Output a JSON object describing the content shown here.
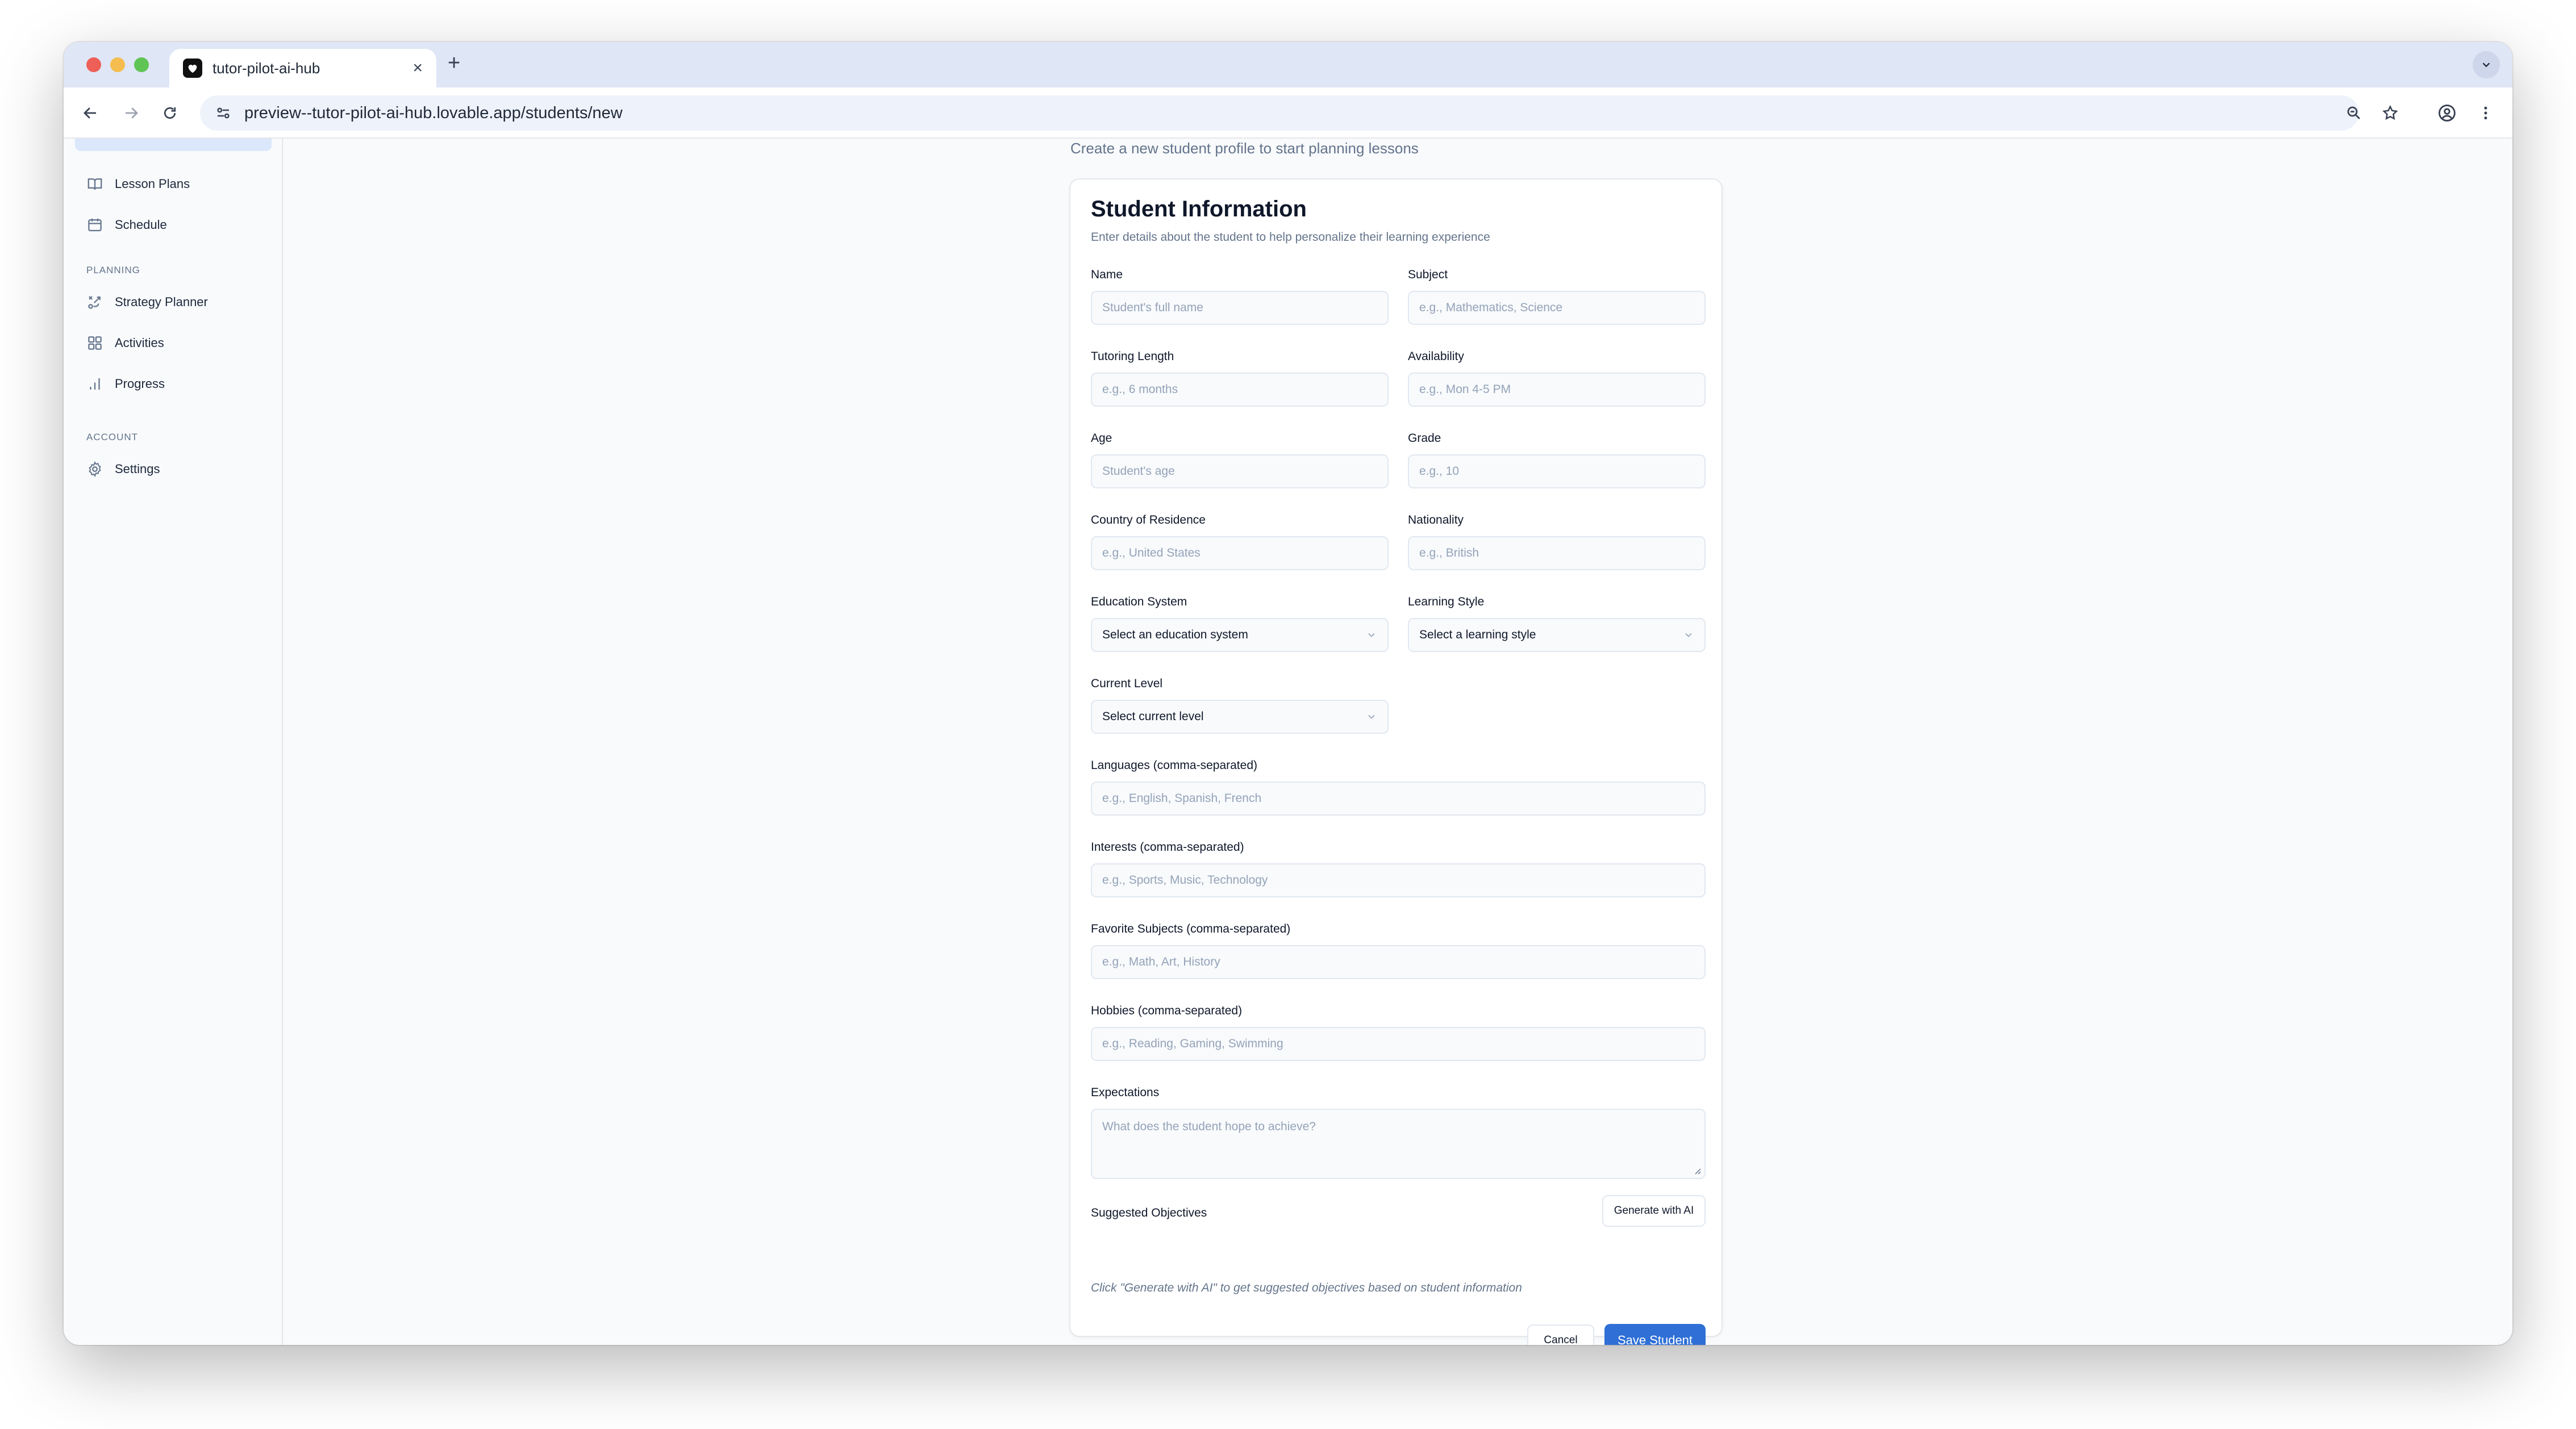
{
  "browser": {
    "tab_title": "tutor-pilot-ai-hub",
    "url": "preview--tutor-pilot-ai-hub.lovable.app/students/new"
  },
  "sidebar": {
    "items_top": [
      {
        "label": "Lesson Plans",
        "icon": "book-open-icon"
      },
      {
        "label": "Schedule",
        "icon": "calendar-icon"
      }
    ],
    "groups": [
      {
        "label": "PLANNING",
        "items": [
          {
            "label": "Strategy Planner",
            "icon": "strategy-icon"
          },
          {
            "label": "Activities",
            "icon": "grid-icon"
          },
          {
            "label": "Progress",
            "icon": "bar-chart-icon"
          }
        ]
      },
      {
        "label": "ACCOUNT",
        "items": [
          {
            "label": "Settings",
            "icon": "gear-icon"
          }
        ]
      }
    ]
  },
  "page": {
    "subtitle": "Create a new student profile to start planning lessons"
  },
  "form": {
    "title": "Student Information",
    "description": "Enter details about the student to help personalize their learning experience",
    "fields": {
      "name": {
        "label": "Name",
        "placeholder": "Student's full name"
      },
      "subject": {
        "label": "Subject",
        "placeholder": "e.g., Mathematics, Science"
      },
      "tutoring_length": {
        "label": "Tutoring Length",
        "placeholder": "e.g., 6 months"
      },
      "availability": {
        "label": "Availability",
        "placeholder": "e.g., Mon 4-5 PM"
      },
      "age": {
        "label": "Age",
        "placeholder": "Student's age"
      },
      "grade": {
        "label": "Grade",
        "placeholder": "e.g., 10"
      },
      "country": {
        "label": "Country of Residence",
        "placeholder": "e.g., United States"
      },
      "nationality": {
        "label": "Nationality",
        "placeholder": "e.g., British"
      },
      "education_system": {
        "label": "Education System",
        "value": "Select an education system"
      },
      "learning_style": {
        "label": "Learning Style",
        "value": "Select a learning style"
      },
      "current_level": {
        "label": "Current Level",
        "value": "Select current level"
      },
      "languages": {
        "label": "Languages (comma-separated)",
        "placeholder": "e.g., English, Spanish, French"
      },
      "interests": {
        "label": "Interests (comma-separated)",
        "placeholder": "e.g., Sports, Music, Technology"
      },
      "favorite_subjects": {
        "label": "Favorite Subjects (comma-separated)",
        "placeholder": "e.g., Math, Art, History"
      },
      "hobbies": {
        "label": "Hobbies (comma-separated)",
        "placeholder": "e.g., Reading, Gaming, Swimming"
      },
      "expectations": {
        "label": "Expectations",
        "placeholder": "What does the student hope to achieve?"
      }
    },
    "objectives": {
      "label": "Suggested Objectives",
      "generate_label": "Generate with AI",
      "hint": "Click \"Generate with AI\" to get suggested objectives based on student information"
    },
    "actions": {
      "cancel_label": "Cancel",
      "save_label": "Save Student"
    }
  },
  "colors": {
    "primary": "#2f6fd6",
    "tab_strip": "#dfe6f6",
    "sidebar_active": "#dbe7fb"
  }
}
